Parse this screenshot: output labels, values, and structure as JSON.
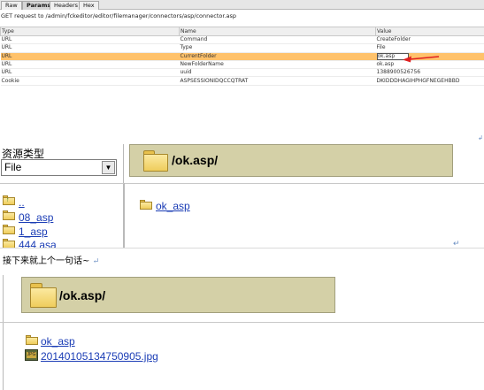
{
  "request_panel": {
    "tabs": [
      "Raw",
      "Params",
      "Headers",
      "Hex"
    ],
    "active_tab": "Params",
    "title": "GET request to /admin/fckeditor/editor/filemanager/connectors/asp/connector.asp",
    "columns": [
      "Type",
      "Name",
      "Value"
    ],
    "rows": [
      {
        "type": "URL",
        "name": "Command",
        "value": "CreateFolder"
      },
      {
        "type": "URL",
        "name": "Type",
        "value": "File"
      },
      {
        "type": "URL",
        "name": "CurrentFolder",
        "value": "ok.asp"
      },
      {
        "type": "URL",
        "name": "NewFolderName",
        "value": "ok.asp"
      },
      {
        "type": "URL",
        "name": "uuid",
        "value": "1388900526756"
      },
      {
        "type": "Cookie",
        "name": "ASPSESSIONIDQCCQTRAT",
        "value": "DKIDDDHAGIHPHGFNEGEHBBD"
      }
    ],
    "selected_row": 2,
    "selection_color": "#ffc26b",
    "arrow_color": "#e02020",
    "end_mark": "↲"
  },
  "file_manager_1": {
    "resource_type_label": "资源类型",
    "resource_type_value": "File",
    "dropdown_glyph": "▼",
    "current_path": "/ok.asp/",
    "folders_left": [
      "..",
      "08_asp",
      "1_asp",
      "444 asa"
    ],
    "folders_right": [
      "ok_asp"
    ]
  },
  "caption": {
    "text": "接下来就上个一句话~",
    "return_mark": "↵",
    "mid_return_mark": "↵"
  },
  "file_manager_2": {
    "current_path": "/ok.asp/",
    "items": [
      {
        "kind": "folder",
        "name": "ok_asp"
      },
      {
        "kind": "jpg",
        "name": "20140105134750905.jpg",
        "icon_label": "JPG"
      }
    ]
  }
}
